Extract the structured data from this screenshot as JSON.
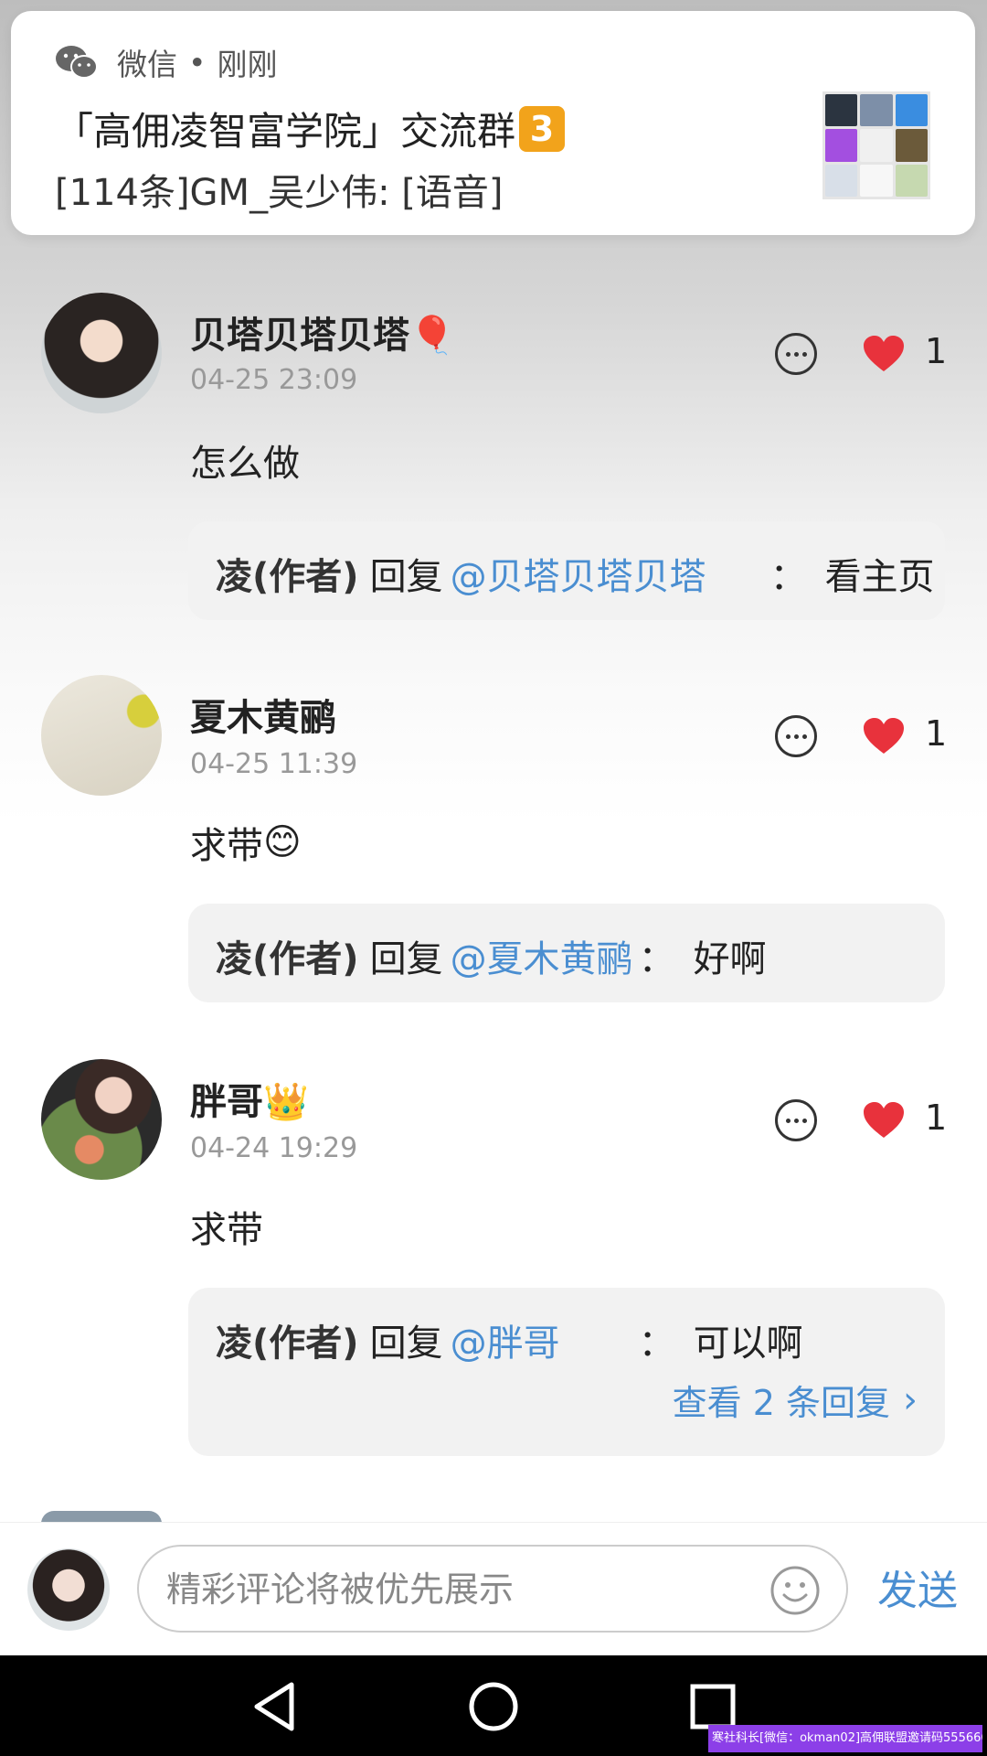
{
  "notification": {
    "app": "微信",
    "separator": "•",
    "time": "刚刚",
    "title": "「高佣凌智富学院」交流群",
    "badge": "3",
    "message": "[114条]GM_吴少伟: [语音]"
  },
  "comments": [
    {
      "name": "贝塔贝塔贝塔",
      "name_emoji": "🎈",
      "time": "04-25 23:09",
      "likes": "1",
      "text": "怎么做",
      "text_emoji": "",
      "reply": {
        "author": "凌(作者)",
        "verb": "回复",
        "mention": "@贝塔贝塔贝塔",
        "colon": "：",
        "text": "看主页"
      }
    },
    {
      "name": "夏木黄鹂",
      "name_emoji": "",
      "time": "04-25 11:39",
      "likes": "1",
      "text": "求带",
      "text_emoji": "😊",
      "reply": {
        "author": "凌(作者)",
        "verb": "回复",
        "mention": "@夏木黄鹂",
        "colon": "：",
        "text": "好啊"
      }
    },
    {
      "name": "胖哥",
      "name_emoji": "👑",
      "time": "04-24 19:29",
      "likes": "1",
      "text": "求带",
      "text_emoji": "",
      "reply": {
        "author": "凌(作者)",
        "verb": "回复",
        "mention": "@胖哥",
        "colon": "：",
        "text": "可以啊"
      },
      "more_replies": "查看 2 条回复"
    }
  ],
  "composer": {
    "placeholder": "精彩评论将被优先展示",
    "send_label": "发送"
  },
  "watermark": "寒社科长[微信：okman02]高佣联盟邀请码555666",
  "colors": {
    "accent": "#4a8ed1",
    "heart": "#e8323c",
    "watermark": "#8c3fe8"
  },
  "icons": [
    "wechat-icon",
    "comment-reply-icon",
    "heart-icon",
    "emoji-icon",
    "back-icon",
    "home-icon",
    "recents-icon"
  ]
}
